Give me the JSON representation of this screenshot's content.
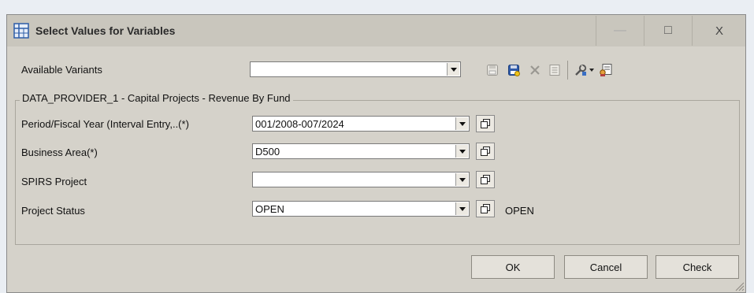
{
  "window": {
    "title": "Select Values for Variables",
    "controls": {
      "minimize": "—",
      "maximize": "□",
      "close": "X"
    }
  },
  "variants": {
    "label": "Available Variants",
    "value": ""
  },
  "toolbar": {
    "icons": [
      "save-icon",
      "save-as-icon",
      "delete-icon",
      "list-icon",
      "tools-icon",
      "dropdown-arrow-icon",
      "personalize-icon"
    ]
  },
  "group": {
    "legend": "DATA_PROVIDER_1 - Capital Projects - Revenue By Fund",
    "rows": [
      {
        "label": "Period/Fiscal Year (Interval Entry,..(*)",
        "value": "001/2008-007/2024",
        "extra": ""
      },
      {
        "label": "Business Area(*)",
        "value": "D500",
        "extra": ""
      },
      {
        "label": "SPIRS Project",
        "value": "",
        "extra": ""
      },
      {
        "label": "Project Status",
        "value": "OPEN",
        "extra": "OPEN"
      }
    ]
  },
  "buttons": {
    "ok": "OK",
    "cancel": "Cancel",
    "check": "Check"
  }
}
